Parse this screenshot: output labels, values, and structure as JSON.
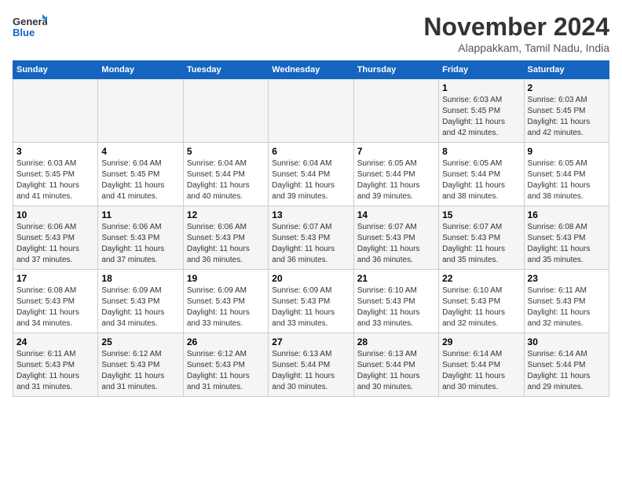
{
  "header": {
    "logo_line1": "General",
    "logo_line2": "Blue",
    "month_title": "November 2024",
    "location": "Alappakkam, Tamil Nadu, India"
  },
  "weekdays": [
    "Sunday",
    "Monday",
    "Tuesday",
    "Wednesday",
    "Thursday",
    "Friday",
    "Saturday"
  ],
  "weeks": [
    [
      {
        "day": "",
        "detail": ""
      },
      {
        "day": "",
        "detail": ""
      },
      {
        "day": "",
        "detail": ""
      },
      {
        "day": "",
        "detail": ""
      },
      {
        "day": "",
        "detail": ""
      },
      {
        "day": "1",
        "detail": "Sunrise: 6:03 AM\nSunset: 5:45 PM\nDaylight: 11 hours\nand 42 minutes."
      },
      {
        "day": "2",
        "detail": "Sunrise: 6:03 AM\nSunset: 5:45 PM\nDaylight: 11 hours\nand 42 minutes."
      }
    ],
    [
      {
        "day": "3",
        "detail": "Sunrise: 6:03 AM\nSunset: 5:45 PM\nDaylight: 11 hours\nand 41 minutes."
      },
      {
        "day": "4",
        "detail": "Sunrise: 6:04 AM\nSunset: 5:45 PM\nDaylight: 11 hours\nand 41 minutes."
      },
      {
        "day": "5",
        "detail": "Sunrise: 6:04 AM\nSunset: 5:44 PM\nDaylight: 11 hours\nand 40 minutes."
      },
      {
        "day": "6",
        "detail": "Sunrise: 6:04 AM\nSunset: 5:44 PM\nDaylight: 11 hours\nand 39 minutes."
      },
      {
        "day": "7",
        "detail": "Sunrise: 6:05 AM\nSunset: 5:44 PM\nDaylight: 11 hours\nand 39 minutes."
      },
      {
        "day": "8",
        "detail": "Sunrise: 6:05 AM\nSunset: 5:44 PM\nDaylight: 11 hours\nand 38 minutes."
      },
      {
        "day": "9",
        "detail": "Sunrise: 6:05 AM\nSunset: 5:44 PM\nDaylight: 11 hours\nand 38 minutes."
      }
    ],
    [
      {
        "day": "10",
        "detail": "Sunrise: 6:06 AM\nSunset: 5:43 PM\nDaylight: 11 hours\nand 37 minutes."
      },
      {
        "day": "11",
        "detail": "Sunrise: 6:06 AM\nSunset: 5:43 PM\nDaylight: 11 hours\nand 37 minutes."
      },
      {
        "day": "12",
        "detail": "Sunrise: 6:06 AM\nSunset: 5:43 PM\nDaylight: 11 hours\nand 36 minutes."
      },
      {
        "day": "13",
        "detail": "Sunrise: 6:07 AM\nSunset: 5:43 PM\nDaylight: 11 hours\nand 36 minutes."
      },
      {
        "day": "14",
        "detail": "Sunrise: 6:07 AM\nSunset: 5:43 PM\nDaylight: 11 hours\nand 36 minutes."
      },
      {
        "day": "15",
        "detail": "Sunrise: 6:07 AM\nSunset: 5:43 PM\nDaylight: 11 hours\nand 35 minutes."
      },
      {
        "day": "16",
        "detail": "Sunrise: 6:08 AM\nSunset: 5:43 PM\nDaylight: 11 hours\nand 35 minutes."
      }
    ],
    [
      {
        "day": "17",
        "detail": "Sunrise: 6:08 AM\nSunset: 5:43 PM\nDaylight: 11 hours\nand 34 minutes."
      },
      {
        "day": "18",
        "detail": "Sunrise: 6:09 AM\nSunset: 5:43 PM\nDaylight: 11 hours\nand 34 minutes."
      },
      {
        "day": "19",
        "detail": "Sunrise: 6:09 AM\nSunset: 5:43 PM\nDaylight: 11 hours\nand 33 minutes."
      },
      {
        "day": "20",
        "detail": "Sunrise: 6:09 AM\nSunset: 5:43 PM\nDaylight: 11 hours\nand 33 minutes."
      },
      {
        "day": "21",
        "detail": "Sunrise: 6:10 AM\nSunset: 5:43 PM\nDaylight: 11 hours\nand 33 minutes."
      },
      {
        "day": "22",
        "detail": "Sunrise: 6:10 AM\nSunset: 5:43 PM\nDaylight: 11 hours\nand 32 minutes."
      },
      {
        "day": "23",
        "detail": "Sunrise: 6:11 AM\nSunset: 5:43 PM\nDaylight: 11 hours\nand 32 minutes."
      }
    ],
    [
      {
        "day": "24",
        "detail": "Sunrise: 6:11 AM\nSunset: 5:43 PM\nDaylight: 11 hours\nand 31 minutes."
      },
      {
        "day": "25",
        "detail": "Sunrise: 6:12 AM\nSunset: 5:43 PM\nDaylight: 11 hours\nand 31 minutes."
      },
      {
        "day": "26",
        "detail": "Sunrise: 6:12 AM\nSunset: 5:43 PM\nDaylight: 11 hours\nand 31 minutes."
      },
      {
        "day": "27",
        "detail": "Sunrise: 6:13 AM\nSunset: 5:44 PM\nDaylight: 11 hours\nand 30 minutes."
      },
      {
        "day": "28",
        "detail": "Sunrise: 6:13 AM\nSunset: 5:44 PM\nDaylight: 11 hours\nand 30 minutes."
      },
      {
        "day": "29",
        "detail": "Sunrise: 6:14 AM\nSunset: 5:44 PM\nDaylight: 11 hours\nand 30 minutes."
      },
      {
        "day": "30",
        "detail": "Sunrise: 6:14 AM\nSunset: 5:44 PM\nDaylight: 11 hours\nand 29 minutes."
      }
    ]
  ]
}
